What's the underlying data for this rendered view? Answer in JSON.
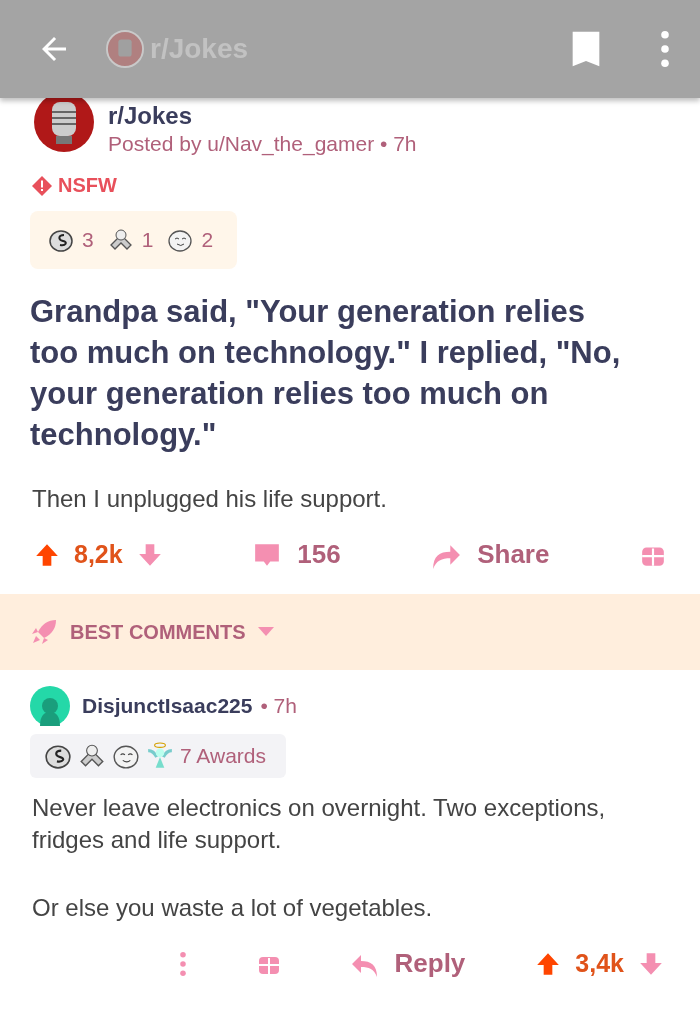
{
  "toolbar": {
    "title": "r/Jokes"
  },
  "post": {
    "subreddit": "r/Jokes",
    "byline": "Posted by u/Nav_the_gamer • 7h",
    "nsfw": "NSFW",
    "awards": [
      {
        "kind": "silver",
        "count": "3"
      },
      {
        "kind": "helpful",
        "count": "1"
      },
      {
        "kind": "wholesome",
        "count": "2"
      }
    ],
    "title": "Grandpa said, \"Your generation relies too much on technology.\" I replied, \"No, your generation relies too much on technology.\"",
    "body": "Then I unplugged his life support.",
    "score": "8,2k",
    "upvoted": true,
    "comments": "156",
    "share": "Share"
  },
  "sort": {
    "label": "BEST COMMENTS"
  },
  "comment": {
    "author": "DisjunctIsaac225",
    "time": "• 7h",
    "awards": [
      {
        "kind": "silver"
      },
      {
        "kind": "helpful"
      },
      {
        "kind": "wholesome"
      },
      {
        "kind": "angel"
      }
    ],
    "awards_label": "7 Awards",
    "body": [
      "Never leave  electronics on overnight. Two exceptions, fridges and life support.",
      "Or else you waste a lot of vegetables."
    ],
    "reply": "Reply",
    "score": "3,4k",
    "upvoted": true
  }
}
